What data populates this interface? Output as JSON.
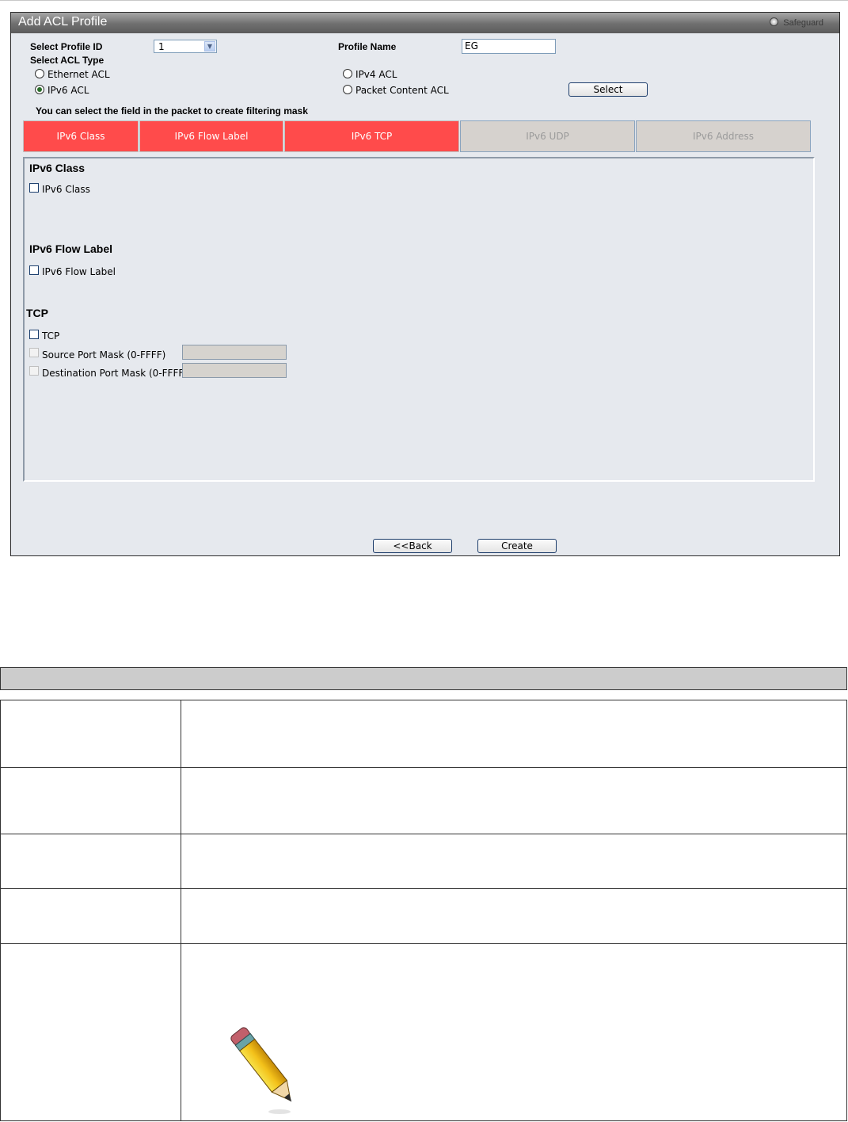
{
  "window": {
    "title": "Add ACL Profile",
    "safeguard_label": "Safeguard"
  },
  "form": {
    "profile_id_label": "Select Profile ID",
    "profile_id_value": "1",
    "profile_name_label": "Profile Name",
    "profile_name_value": "EG",
    "acl_type_label": "Select ACL Type",
    "acl_types": [
      {
        "label": "Ethernet ACL",
        "selected": false
      },
      {
        "label": "IPv6 ACL",
        "selected": true
      },
      {
        "label": "IPv4 ACL",
        "selected": false
      },
      {
        "label": "Packet Content ACL",
        "selected": false
      }
    ],
    "select_button": "Select",
    "mask_hint": "You can select the field in the packet to create filtering mask"
  },
  "tabs": [
    {
      "label": "IPv6 Class",
      "active": true
    },
    {
      "label": "IPv6 Flow Label",
      "active": true
    },
    {
      "label": "IPv6 TCP",
      "active": true
    },
    {
      "label": "IPv6 UDP",
      "active": false
    },
    {
      "label": "IPv6 Address",
      "active": false
    }
  ],
  "sections": {
    "class": {
      "heading": "IPv6 Class",
      "checkbox_label": "IPv6 Class"
    },
    "flow": {
      "heading": "IPv6 Flow Label",
      "checkbox_label": "IPv6 Flow Label"
    },
    "tcp": {
      "heading": "TCP",
      "checkbox_label": "TCP",
      "source_mask_label": "Source Port Mask (0-FFFF)",
      "source_mask_value": "",
      "dest_mask_label": "Destination Port Mask (0-FFFF)",
      "dest_mask_value": ""
    }
  },
  "buttons": {
    "back": "<<Back",
    "create": "Create"
  },
  "colors": {
    "active_tab": "#ff4b4b",
    "inactive_tab": "#d6d2ce",
    "panel_bg": "#e6e9ee"
  }
}
